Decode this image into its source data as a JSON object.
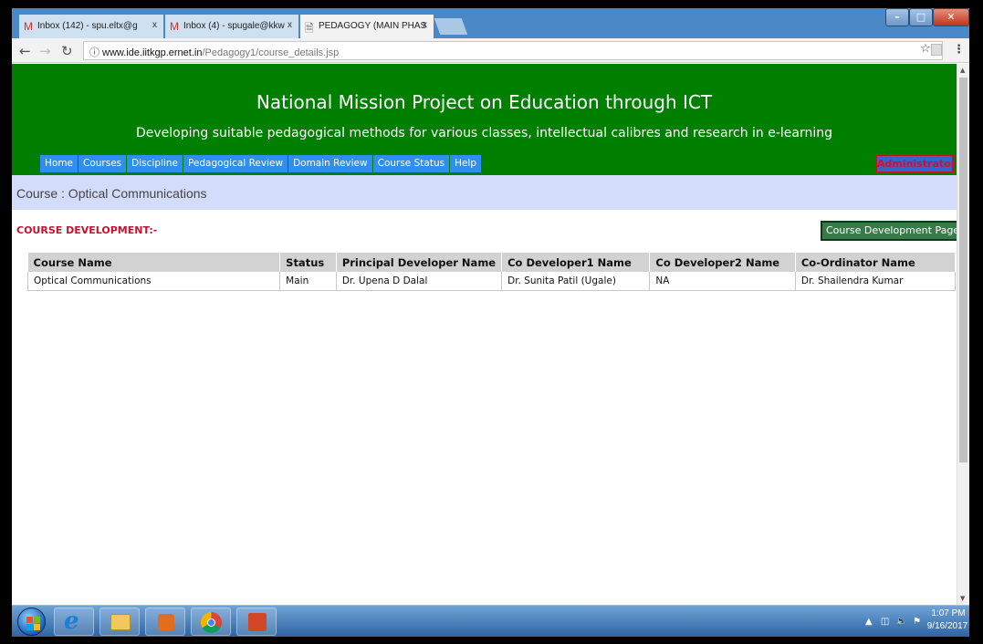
{
  "browser": {
    "tabs": [
      {
        "label": "Inbox (142) - spu.eltx@g",
        "icon": "gmail-icon"
      },
      {
        "label": "Inbox (4) - spugale@kkw",
        "icon": "gmail-icon"
      },
      {
        "label": "PEDAGOGY (MAIN PHAS",
        "icon": "page-icon"
      }
    ],
    "tab_close_glyph": "x",
    "url": {
      "host": "www.ide.iitkgp.ernet.in",
      "path": "/Pedagogy1/course_details.jsp"
    }
  },
  "site": {
    "title": "National Mission Project on Education through ICT",
    "subtitle": "Developing suitable pedagogical methods for various classes, intellectual calibres and research in e-learning",
    "nav": [
      "Home",
      "Courses",
      "Discipline",
      "Pedagogical Review",
      "Domain Review",
      "Course Status",
      "Help"
    ],
    "user_role": "Administrator",
    "colors": {
      "header_green": "#017f00",
      "nav_blue": "#2f8ff0",
      "course_bar": "#d4dcfb",
      "heading_red": "#c8102e"
    }
  },
  "course": {
    "title": "Course : Optical Communications",
    "section_heading": "COURSE DEVELOPMENT:-",
    "dev_page_button": "Course Development Page"
  },
  "table": {
    "headers": [
      "Course Name",
      "Status",
      "Principal Developer Name",
      "Co Developer1 Name",
      "Co Developer2 Name",
      "Co-Ordinator Name"
    ],
    "rows": [
      [
        "Optical Communications",
        "Main",
        "Dr. Upena D Dalal",
        "Dr. Sunita Patil (Ugale)",
        "NA",
        "Dr. Shailendra Kumar"
      ]
    ]
  },
  "taskbar": {
    "time": "1:07 PM",
    "date": "9/16/2017"
  }
}
